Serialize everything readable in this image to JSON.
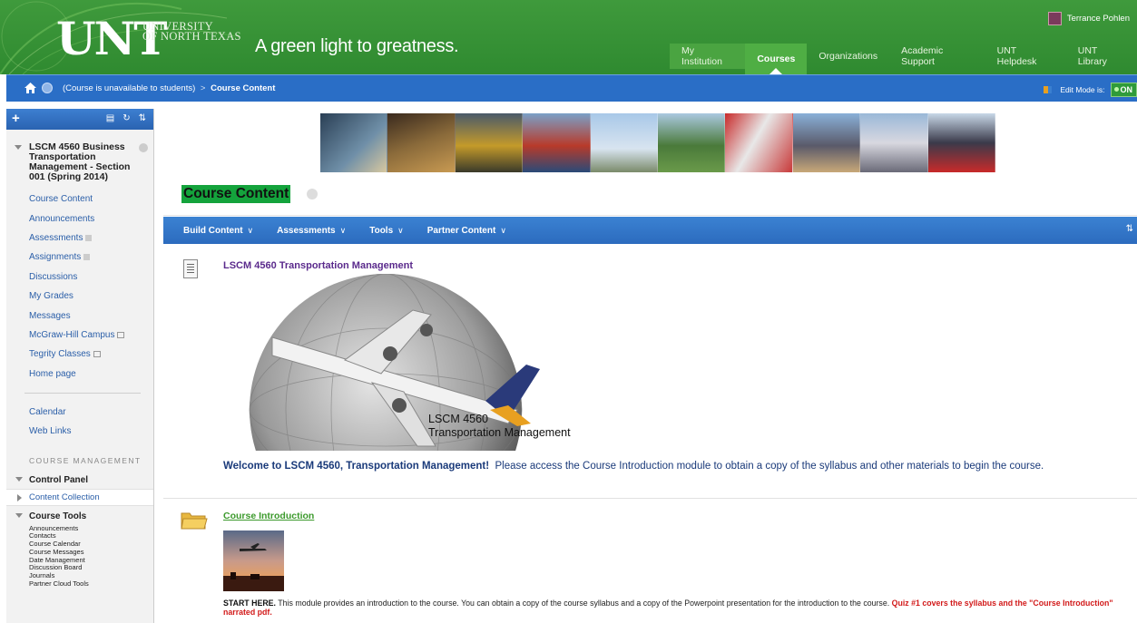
{
  "header": {
    "logo": "UNT",
    "university_line1": "UNIVERSITY",
    "university_line2": "OF NORTH TEXAS",
    "tagline": "A green light to greatness.",
    "user_name": "Terrance Pohlen",
    "tabs": [
      {
        "label": "My Institution"
      },
      {
        "label": "Courses"
      },
      {
        "label": "Organizations"
      },
      {
        "label": "Academic Support"
      },
      {
        "label": "UNT Helpdesk"
      },
      {
        "label": "UNT Library"
      }
    ],
    "brand_color": "#3a9a3a"
  },
  "breadcrumb": {
    "part1": "(Course is unavailable to students)",
    "separator": ">",
    "part2": "Course Content",
    "edit_mode_label": "Edit Mode is:",
    "edit_mode_value": "ON"
  },
  "sidebar": {
    "add_label": "+",
    "course_title": "LSCM 4560 Business Transportation Management - Section 001 (Spring 2014)",
    "links": [
      {
        "label": "Course Content"
      },
      {
        "label": "Announcements"
      },
      {
        "label": "Assessments"
      },
      {
        "label": "Assignments"
      },
      {
        "label": "Discussions"
      },
      {
        "label": "My Grades"
      },
      {
        "label": "Messages"
      },
      {
        "label": "McGraw-Hill Campus"
      },
      {
        "label": "Tegrity Classes"
      },
      {
        "label": "Home page"
      }
    ],
    "links2": [
      {
        "label": "Calendar"
      },
      {
        "label": "Web Links"
      }
    ],
    "course_management_heading": "COURSE MANAGEMENT",
    "control_panel": "Control Panel",
    "content_collection": "Content Collection",
    "course_tools": "Course Tools",
    "course_tools_items": [
      "Announcements",
      "Contacts",
      "Course Calendar",
      "Course Messages",
      "Date Management",
      "Discussion Board",
      "Journals",
      "Partner Cloud Tools"
    ],
    "accent_color": "#2a6ec6"
  },
  "main": {
    "page_title": "Course Content",
    "action_bar": [
      {
        "label": "Build Content"
      },
      {
        "label": "Assessments"
      },
      {
        "label": "Tools"
      },
      {
        "label": "Partner Content"
      }
    ],
    "items": [
      {
        "title": "LSCM 4560 Transportation Management",
        "image_caption_line1": "LSCM 4560",
        "image_caption_line2": "Transportation Management",
        "welcome_bold": "Welcome to LSCM 4560, Transportation Management!",
        "welcome_rest": "Please access the Course Introduction module to obtain a copy of the syllabus and other materials to begin the course."
      },
      {
        "title": "Course Introduction",
        "start_bold": "START HERE.",
        "start_text": "This module provides an introduction to the course. You can obtain a copy of the course syllabus and a copy of the Powerpoint presentation for the introduction to the course.",
        "start_red": "Quiz #1 covers the syllabus and the \"Course Introduction\" narrated pdf."
      }
    ]
  }
}
